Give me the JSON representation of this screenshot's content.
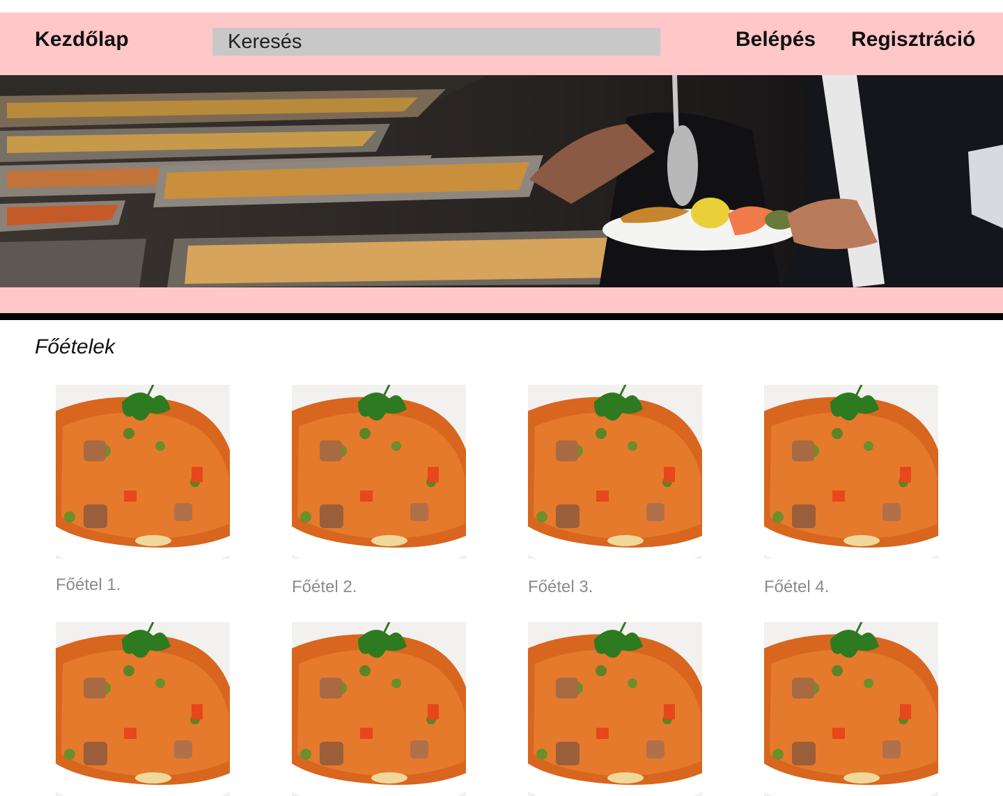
{
  "header": {
    "home_label": "Kezdőlap",
    "search_placeholder": "Keresés",
    "login_label": "Belépés",
    "register_label": "Regisztráció",
    "background_color": "#ffc7c7"
  },
  "hero": {
    "image": "buffet-serving-photo"
  },
  "section": {
    "title": "Főételek"
  },
  "dishes": [
    {
      "label": "Főétel 1.",
      "image": "rice-dish-photo"
    },
    {
      "label": "Főétel 2.",
      "image": "rice-dish-photo"
    },
    {
      "label": "Főétel 3.",
      "image": "rice-dish-photo"
    },
    {
      "label": "Főétel 4.",
      "image": "rice-dish-photo"
    },
    {
      "label": "",
      "image": "rice-dish-photo"
    },
    {
      "label": "",
      "image": "rice-dish-photo"
    },
    {
      "label": "",
      "image": "rice-dish-photo"
    },
    {
      "label": "",
      "image": "rice-dish-photo"
    }
  ]
}
